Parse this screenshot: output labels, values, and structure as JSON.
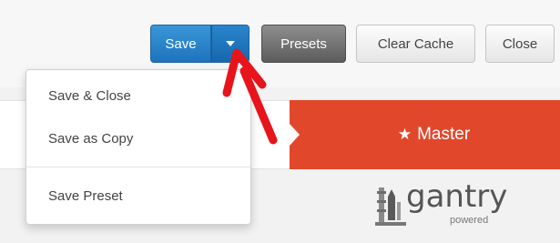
{
  "toolbar": {
    "save_label": "Save",
    "presets_label": "Presets",
    "clear_cache_label": "Clear Cache",
    "close_label": "Close"
  },
  "save_menu": {
    "items": [
      {
        "label": "Save & Close"
      },
      {
        "label": "Save as Copy"
      },
      {
        "label": "Save Preset"
      }
    ]
  },
  "banner": {
    "label": "Master",
    "star": "★"
  },
  "logo": {
    "word": "gantry",
    "subtitle": "powered"
  },
  "colors": {
    "save_blue": "#1d74bd",
    "presets_gray": "#5c5c5c",
    "master_red": "#e1482b",
    "annotation_arrow": "#e8141b"
  },
  "icons": {
    "caret": "chevron-down-icon",
    "star": "star-icon",
    "rocket": "rocket-icon",
    "arrow": "annotation-arrow-icon"
  }
}
